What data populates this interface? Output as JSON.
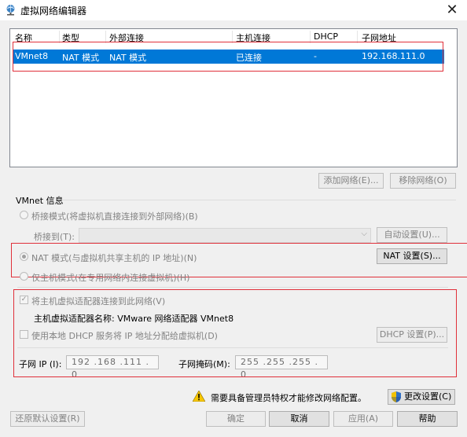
{
  "window": {
    "title": "虚拟网络编辑器",
    "close_glyph": "✕"
  },
  "table": {
    "columns": [
      "名称",
      "类型",
      "外部连接",
      "主机连接",
      "DHCP",
      "子网地址"
    ],
    "rows": [
      {
        "name": "VMnet8",
        "type": "NAT 模式",
        "external": "NAT 模式",
        "host": "已连接",
        "dhcp": "-",
        "subnet": "192.168.111.0",
        "selected": true
      }
    ]
  },
  "list_buttons": {
    "add": "添加网络(E)...",
    "remove": "移除网络(O)"
  },
  "vmnet_info": {
    "group_label": "VMnet 信息",
    "bridged_label": "桥接模式(将虚拟机直接连接到外部网络)(B)",
    "bridge_to_label": "桥接到(T):",
    "bridge_to_value": "",
    "auto_settings": "自动设置(U)...",
    "nat_label": "NAT 模式(与虚拟机共享主机的 IP 地址)(N)",
    "nat_settings": "NAT 设置(S)...",
    "hostonly_label": "仅主机模式(在专用网络内连接虚拟机)(H)",
    "connect_adapter_label": "将主机虚拟适配器连接到此网络(V)",
    "adapter_name_label": "主机虚拟适配器名称: VMware 网络适配器 VMnet8",
    "dhcp_label": "使用本地 DHCP 服务将 IP 地址分配给虚拟机(D)",
    "dhcp_settings": "DHCP 设置(P)...",
    "subnet_ip_label": "子网 IP (I):",
    "subnet_ip": "192 .168 .111 . 0",
    "subnet_mask_label": "子网掩码(M):",
    "subnet_mask": "255 .255 .255 . 0"
  },
  "admin": {
    "warning": "需要具备管理员特权才能修改网络配置。",
    "change_settings": "更改设置(C)"
  },
  "footer": {
    "restore": "还原默认设置(R)",
    "ok": "确定",
    "cancel": "取消",
    "apply": "应用(A)",
    "help": "帮助"
  },
  "colors": {
    "selection": "#0078d7",
    "annotation_red": "#e0303a"
  },
  "icons": {
    "title": "network-globe-icon",
    "warning": "warning-icon",
    "shield": "uac-shield-icon"
  }
}
